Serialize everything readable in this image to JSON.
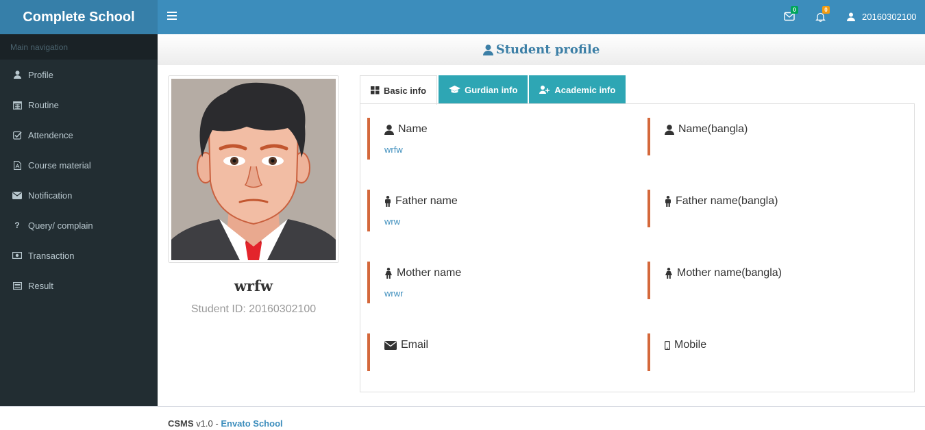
{
  "app": {
    "title": "Complete School"
  },
  "topbar": {
    "messages_count": "0",
    "notifications_count": "0",
    "user_id": "20160302100",
    "colors": {
      "bar": "#3c8dbc",
      "logo": "#367fa9",
      "message_badge": "#00a65a",
      "notification_badge": "#f39c12"
    }
  },
  "sidebar": {
    "header": "Main navigation",
    "items": [
      {
        "label": "Profile",
        "icon": "user-icon"
      },
      {
        "label": "Routine",
        "icon": "calendar-icon"
      },
      {
        "label": "Attendence",
        "icon": "check-square-icon"
      },
      {
        "label": "Course material",
        "icon": "file-pdf-icon"
      },
      {
        "label": "Notification",
        "icon": "envelope-icon"
      },
      {
        "label": "Query/ complain",
        "icon": "question-icon"
      },
      {
        "label": "Transaction",
        "icon": "money-icon"
      },
      {
        "label": "Result",
        "icon": "list-icon"
      }
    ]
  },
  "page": {
    "title": "Student profile"
  },
  "student": {
    "name": "wrfw",
    "id_text": "Student ID: 20160302100"
  },
  "tabs": [
    {
      "label": "Basic info",
      "icon": "grid-icon",
      "active": true
    },
    {
      "label": "Gurdian info",
      "icon": "graduation-cap-icon",
      "active": false
    },
    {
      "label": "Academic info",
      "icon": "user-plus-icon",
      "active": false
    }
  ],
  "basic_info": {
    "name_label": "Name",
    "name_value": "wrfw",
    "name_bangla_label": "Name(bangla)",
    "name_bangla_value": "",
    "father_label": "Father name",
    "father_value": "wrw",
    "father_bangla_label": "Father name(bangla)",
    "father_bangla_value": "",
    "mother_label": "Mother name",
    "mother_value": "wrwr",
    "mother_bangla_label": "Mother name(bangla)",
    "mother_bangla_value": "",
    "email_label": "Email",
    "email_value": "",
    "mobile_label": "Mobile",
    "mobile_value": "",
    "accent_color": "#d4683b"
  },
  "footer": {
    "brand": "CSMS",
    "version": "v1.0 -",
    "link": "Envato School"
  }
}
